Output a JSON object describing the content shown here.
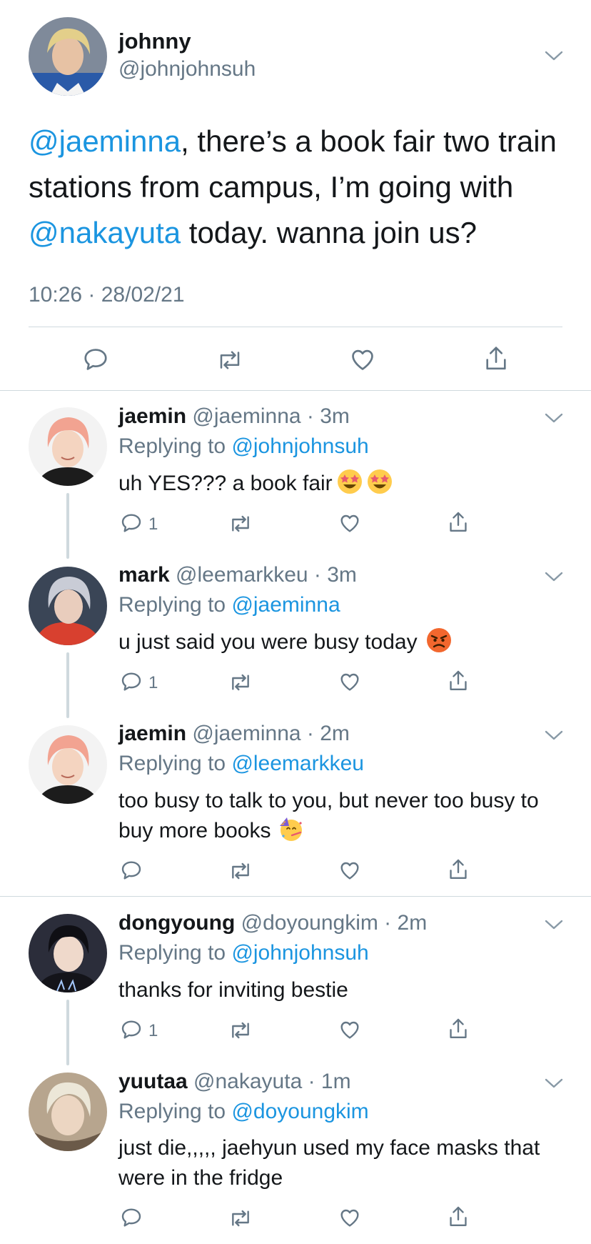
{
  "main_tweet": {
    "name": "johnny",
    "handle": "@johnjohnsuh",
    "text_parts": {
      "m1": "@jaeminna",
      "t1": ", there’s a book fair two train stations from campus, I’m going with ",
      "m2": "@nakayuta",
      "t2": " today. wanna join us?"
    },
    "timestamp": "10:26 · 28/02/21",
    "icons": [
      "reply-icon",
      "retweet-icon",
      "like-icon",
      "share-icon"
    ]
  },
  "replies": [
    {
      "name": "jaemin",
      "handle_time": " @jaeminna · 3m",
      "replying_label": "Replying to ",
      "replying_to": "@johnjohnsuh",
      "text": "uh YES??? a book fair",
      "emoji": [
        "star-struck-emoji",
        "star-struck-emoji"
      ],
      "reply_count": "1"
    },
    {
      "name": "mark",
      "handle_time": " @leemarkkeu · 3m",
      "replying_label": "Replying to ",
      "replying_to": "@jaeminna",
      "text": "u just said you were busy today",
      "emoji": [
        "angry-face-emoji"
      ],
      "reply_count": "1"
    },
    {
      "name": "jaemin",
      "handle_time": " @jaeminna · 2m",
      "replying_label": "Replying to ",
      "replying_to": "@leemarkkeu",
      "text": "too busy to talk to you, but never too busy to buy more books",
      "emoji": [
        "partying-face-emoji"
      ],
      "reply_count": ""
    },
    {
      "name": "dongyoung",
      "handle_time": " @doyoungkim · 2m",
      "replying_label": "Replying to ",
      "replying_to": "@johnjohnsuh",
      "text": "thanks for inviting bestie",
      "emoji": [],
      "reply_count": "1"
    },
    {
      "name": "yuutaa",
      "handle_time": " @nakayuta · 1m",
      "replying_label": "Replying to ",
      "replying_to": "@doyoungkim",
      "text": "just die,,,,, jaehyun used my face masks that were in the fridge",
      "emoji": [],
      "reply_count": ""
    }
  ],
  "colors": {
    "link": "#1b95e0",
    "secondary_text": "#657786",
    "divider": "#cfd9de"
  }
}
